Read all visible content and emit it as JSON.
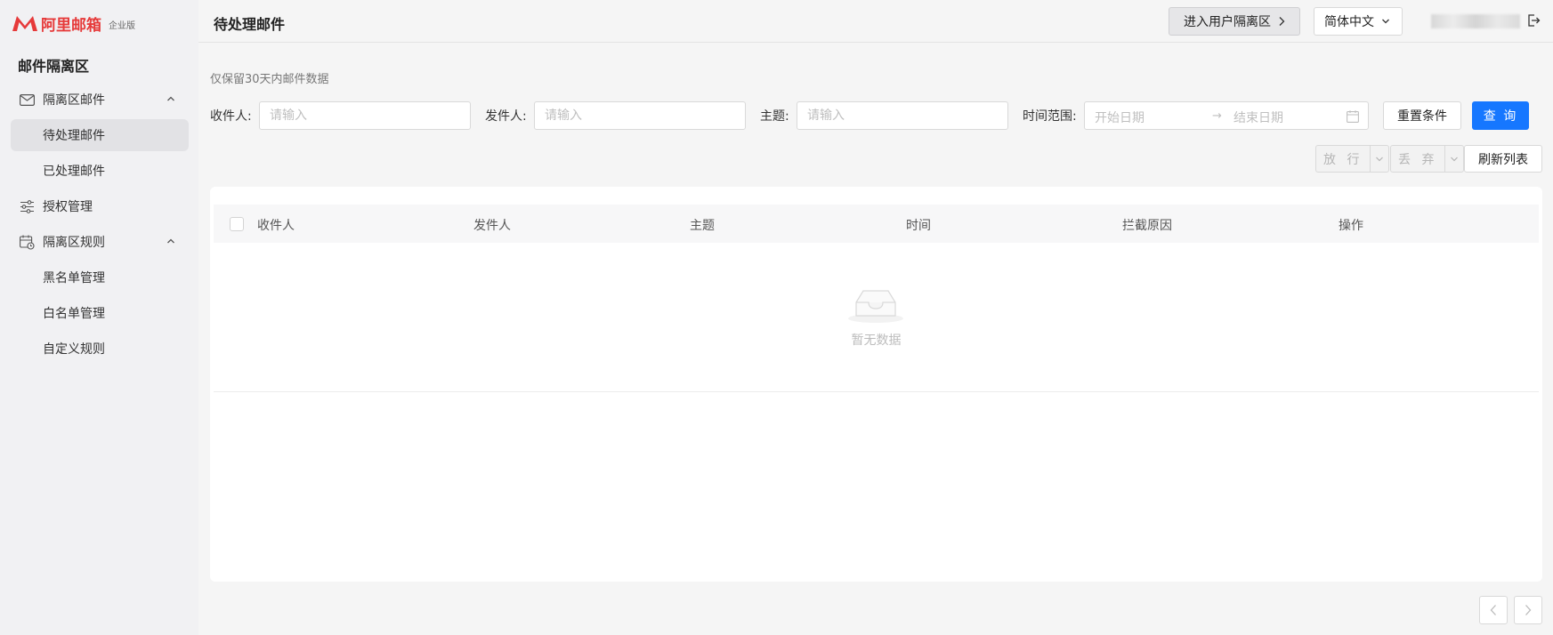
{
  "brand": {
    "logo_text": "阿里邮箱",
    "edition": "企业版",
    "accent_color": "#e63a3a"
  },
  "sidebar": {
    "title": "邮件隔离区",
    "items": [
      {
        "label": "隔离区邮件",
        "icon": "mail-icon",
        "expanded": true
      },
      {
        "label": "待处理邮件",
        "active": true
      },
      {
        "label": "已处理邮件"
      },
      {
        "label": "授权管理",
        "icon": "sliders-icon"
      },
      {
        "label": "隔离区规则",
        "icon": "calendar-rule-icon",
        "expanded": true
      },
      {
        "label": "黑名单管理"
      },
      {
        "label": "白名单管理"
      },
      {
        "label": "自定义规则"
      }
    ]
  },
  "header": {
    "title": "待处理邮件",
    "enter_button": "进入用户隔离区",
    "language": "简体中文"
  },
  "filters": {
    "hint": "仅保留30天内邮件数据",
    "recipient_label": "收件人:",
    "recipient_placeholder": "请输入",
    "sender_label": "发件人:",
    "sender_placeholder": "请输入",
    "subject_label": "主题:",
    "subject_placeholder": "请输入",
    "time_label": "时间范围:",
    "start_placeholder": "开始日期",
    "end_placeholder": "结束日期",
    "arrow": "→",
    "reset_button": "重置条件",
    "query_button": "查 询"
  },
  "actions": {
    "release": "放 行",
    "discard": "丢 弃",
    "refresh": "刷新列表"
  },
  "table": {
    "columns": [
      "收件人",
      "发件人",
      "主题",
      "时间",
      "拦截原因",
      "操作"
    ],
    "rows": [],
    "empty_text": "暂无数据"
  },
  "colors": {
    "primary": "#1677ff"
  }
}
